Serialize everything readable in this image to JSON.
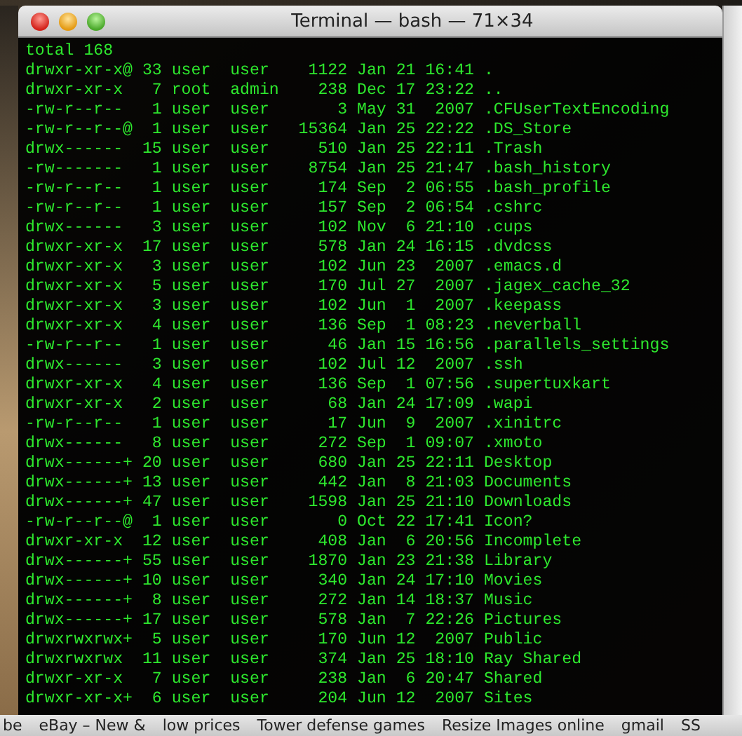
{
  "window": {
    "title": "Terminal — bash — 71×34"
  },
  "lines": [
    "total 168",
    "drwxr-xr-x@ 33 user  user    1122 Jan 21 16:41 .",
    "drwxr-xr-x   7 root  admin    238 Dec 17 23:22 ..",
    "-rw-r--r--   1 user  user       3 May 31  2007 .CFUserTextEncoding",
    "-rw-r--r--@  1 user  user   15364 Jan 25 22:22 .DS_Store",
    "drwx------  15 user  user     510 Jan 25 22:11 .Trash",
    "-rw-------   1 user  user    8754 Jan 25 21:47 .bash_history",
    "-rw-r--r--   1 user  user     174 Sep  2 06:55 .bash_profile",
    "-rw-r--r--   1 user  user     157 Sep  2 06:54 .cshrc",
    "drwx------   3 user  user     102 Nov  6 21:10 .cups",
    "drwxr-xr-x  17 user  user     578 Jan 24 16:15 .dvdcss",
    "drwxr-xr-x   3 user  user     102 Jun 23  2007 .emacs.d",
    "drwxr-xr-x   5 user  user     170 Jul 27  2007 .jagex_cache_32",
    "drwxr-xr-x   3 user  user     102 Jun  1  2007 .keepass",
    "drwxr-xr-x   4 user  user     136 Sep  1 08:23 .neverball",
    "-rw-r--r--   1 user  user      46 Jan 15 16:56 .parallels_settings",
    "drwx------   3 user  user     102 Jul 12  2007 .ssh",
    "drwxr-xr-x   4 user  user     136 Sep  1 07:56 .supertuxkart",
    "drwxr-xr-x   2 user  user      68 Jan 24 17:09 .wapi",
    "-rw-r--r--   1 user  user      17 Jun  9  2007 .xinitrc",
    "drwx------   8 user  user     272 Sep  1 09:07 .xmoto",
    "drwx------+ 20 user  user     680 Jan 25 22:11 Desktop",
    "drwx------+ 13 user  user     442 Jan  8 21:03 Documents",
    "drwx------+ 47 user  user    1598 Jan 25 21:10 Downloads",
    "-rw-r--r--@  1 user  user       0 Oct 22 17:41 Icon?",
    "drwxr-xr-x  12 user  user     408 Jan  6 20:56 Incomplete",
    "drwx------+ 55 user  user    1870 Jan 23 21:38 Library",
    "drwx------+ 10 user  user     340 Jan 24 17:10 Movies",
    "drwx------+  8 user  user     272 Jan 14 18:37 Music",
    "drwx------+ 17 user  user     578 Jan  7 22:26 Pictures",
    "drwxrwxrwx+  5 user  user     170 Jun 12  2007 Public",
    "drwxrwxrwx  11 user  user     374 Jan 25 18:10 Ray Shared",
    "drwxr-xr-x   7 user  user     238 Jan  6 20:47 Shared",
    "drwxr-xr-x+  6 user  user     204 Jun 12  2007 Sites"
  ],
  "bookmarks": [
    "be",
    "eBay – New &",
    "low prices",
    "Tower defense games",
    "Resize Images online",
    "gmail",
    "SS"
  ]
}
